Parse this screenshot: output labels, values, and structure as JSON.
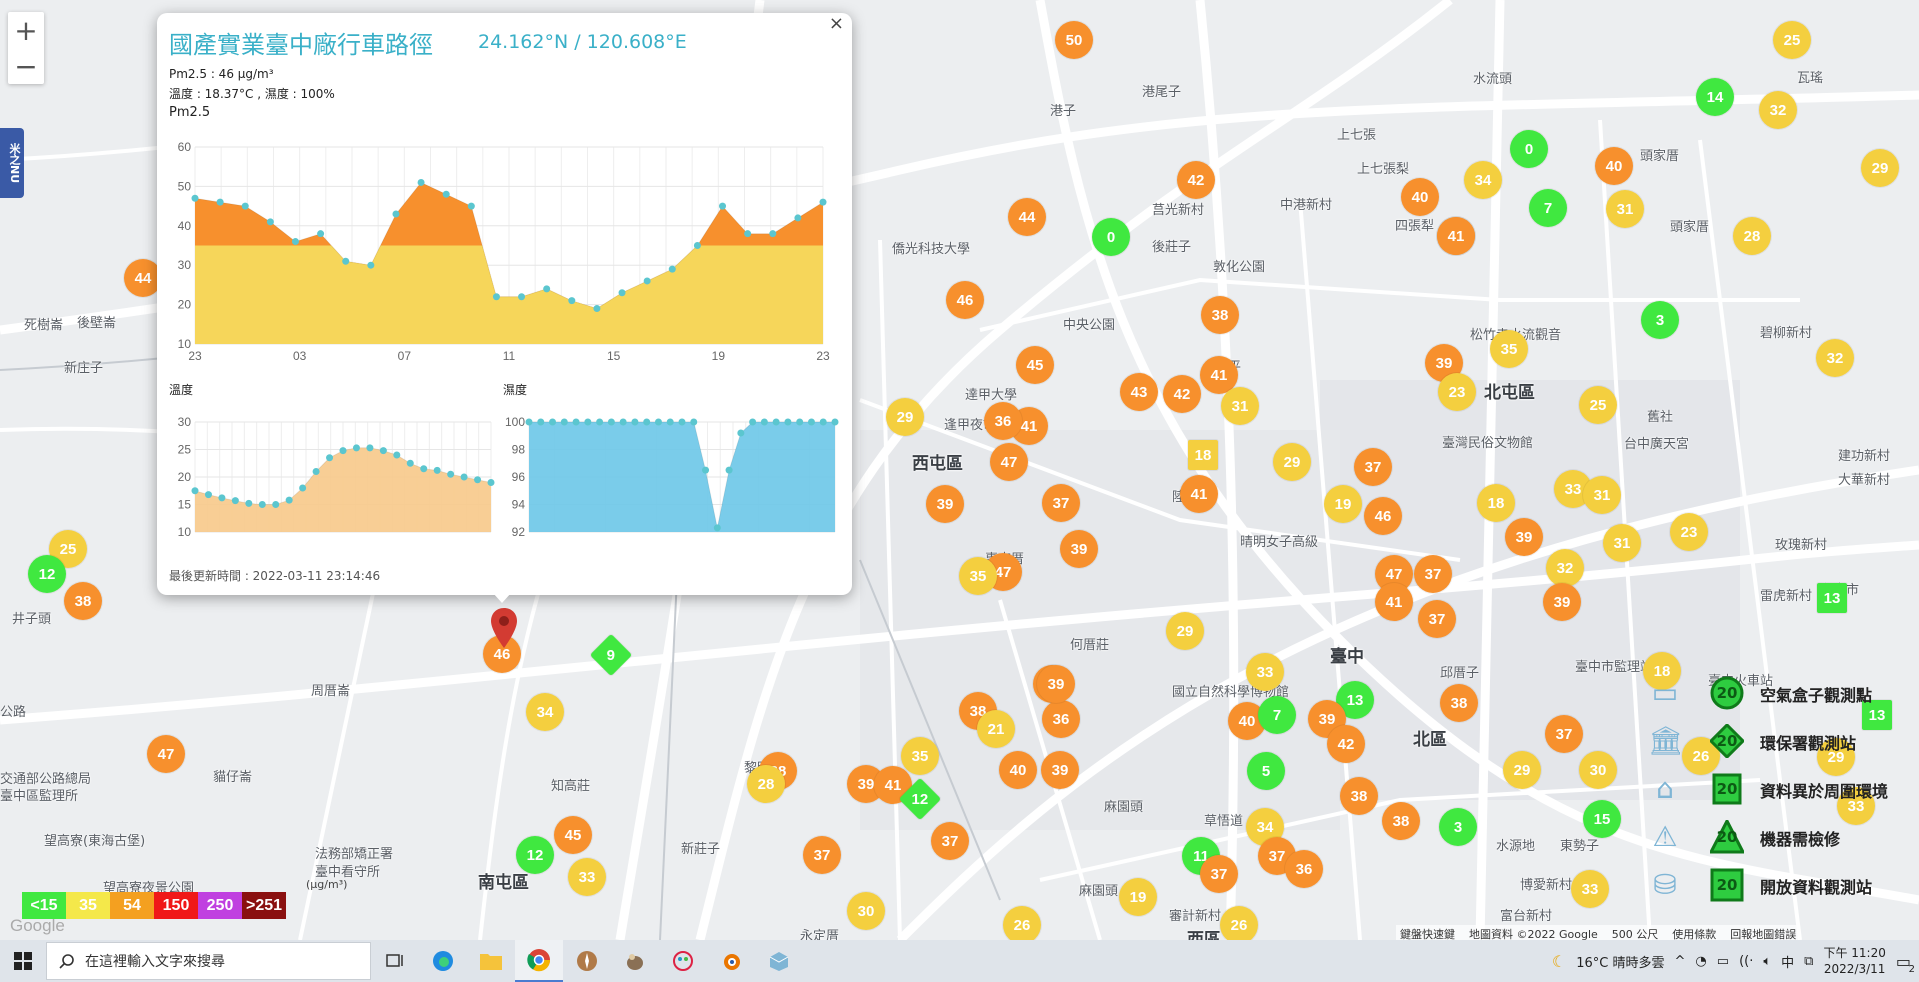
{
  "map": {
    "zoom_in": "+",
    "zoom_out": "−",
    "side_tab_label": "米之NU",
    "google_logo": "Google",
    "places": [
      {
        "t": "港尾子",
        "x": 1142,
        "y": 81
      },
      {
        "t": "港子",
        "x": 1050,
        "y": 100
      },
      {
        "t": "上七張",
        "x": 1337,
        "y": 124
      },
      {
        "t": "上七張梨",
        "x": 1357,
        "y": 158
      },
      {
        "t": "中港新村",
        "x": 1280,
        "y": 194
      },
      {
        "t": "後莊子",
        "x": 1152,
        "y": 236
      },
      {
        "t": "莒光新村",
        "x": 1152,
        "y": 199
      },
      {
        "t": "敦化公園",
        "x": 1213,
        "y": 256
      },
      {
        "t": "中央公園",
        "x": 1063,
        "y": 314
      },
      {
        "t": "四張犁",
        "x": 1395,
        "y": 215
      },
      {
        "t": "頭家厝",
        "x": 1640,
        "y": 145
      },
      {
        "t": "頭家厝",
        "x": 1670,
        "y": 216
      },
      {
        "t": "瓦瑤",
        "x": 1797,
        "y": 67
      },
      {
        "t": "水流頭",
        "x": 1473,
        "y": 68
      },
      {
        "t": "北屯區",
        "x": 1484,
        "y": 378
      },
      {
        "t": "碧柳新村",
        "x": 1760,
        "y": 322
      },
      {
        "t": "松竹寺水流觀音",
        "x": 1470,
        "y": 324
      },
      {
        "t": "臺灣民俗文物館",
        "x": 1442,
        "y": 432
      },
      {
        "t": "舊社",
        "x": 1647,
        "y": 406
      },
      {
        "t": "建功新村",
        "x": 1838,
        "y": 445
      },
      {
        "t": "大華新村",
        "x": 1838,
        "y": 469
      },
      {
        "t": "玫瑰新村",
        "x": 1775,
        "y": 534
      },
      {
        "t": "雷虎新村",
        "x": 1760,
        "y": 585
      },
      {
        "t": "西屯區",
        "x": 912,
        "y": 449
      },
      {
        "t": "陳平",
        "x": 1215,
        "y": 356
      },
      {
        "t": "陸光七",
        "x": 1172,
        "y": 486
      },
      {
        "t": "惠來厝",
        "x": 985,
        "y": 548
      },
      {
        "t": "何厝莊",
        "x": 1070,
        "y": 634
      },
      {
        "t": "臺中",
        "x": 1330,
        "y": 642
      },
      {
        "t": "北區",
        "x": 1413,
        "y": 725
      },
      {
        "t": "邱厝子",
        "x": 1440,
        "y": 662
      },
      {
        "t": "東勢子",
        "x": 1560,
        "y": 835
      },
      {
        "t": "水源地",
        "x": 1496,
        "y": 835
      },
      {
        "t": "博愛新村",
        "x": 1520,
        "y": 874
      },
      {
        "t": "富台新村",
        "x": 1500,
        "y": 905
      },
      {
        "t": "草悟道",
        "x": 1204,
        "y": 810
      },
      {
        "t": "審計新村",
        "x": 1169,
        "y": 905
      },
      {
        "t": "西區",
        "x": 1187,
        "y": 925
      },
      {
        "t": "麻園頭",
        "x": 1104,
        "y": 796
      },
      {
        "t": "麻園頭",
        "x": 1079,
        "y": 880
      },
      {
        "t": "黎明新村",
        "x": 744,
        "y": 757
      },
      {
        "t": "知高莊",
        "x": 551,
        "y": 775
      },
      {
        "t": "新莊子",
        "x": 681,
        "y": 838
      },
      {
        "t": "永定厝",
        "x": 800,
        "y": 925
      },
      {
        "t": "南屯區",
        "x": 478,
        "y": 868
      },
      {
        "t": "周厝崙",
        "x": 311,
        "y": 680
      },
      {
        "t": "貓仔崙",
        "x": 213,
        "y": 766
      },
      {
        "t": "井子頭",
        "x": 12,
        "y": 608
      },
      {
        "t": "新庄子",
        "x": 64,
        "y": 357
      },
      {
        "t": "後壁崙",
        "x": 77,
        "y": 312
      },
      {
        "t": "死樹崙",
        "x": 24,
        "y": 314
      },
      {
        "t": "望高寮夜景公園",
        "x": 103,
        "y": 877
      },
      {
        "t": "望高寮(東海古堡)",
        "x": 44,
        "y": 830
      },
      {
        "t": "法務部矯正署",
        "x": 315,
        "y": 843
      },
      {
        "t": "臺中看守所",
        "x": 315,
        "y": 861
      },
      {
        "t": "交通部公路總局",
        "x": 0,
        "y": 768
      },
      {
        "t": "臺中區監理所",
        "x": 0,
        "y": 785
      },
      {
        "t": "公路",
        "x": 0,
        "y": 701
      },
      {
        "t": "達甲大學",
        "x": 965,
        "y": 384
      },
      {
        "t": "逢甲夜市",
        "x": 944,
        "y": 414
      },
      {
        "t": "僑光科技大學",
        "x": 892,
        "y": 238
      },
      {
        "t": "臺中市監理站",
        "x": 1575,
        "y": 656
      },
      {
        "t": "臺中火車站",
        "x": 1708,
        "y": 670
      },
      {
        "t": "晴明女子高級",
        "x": 1240,
        "y": 531
      },
      {
        "t": "國立自然科學博物館",
        "x": 1172,
        "y": 681
      },
      {
        "t": "台中廣天宮",
        "x": 1624,
        "y": 433
      },
      {
        "t": "台中市",
        "x": 1820,
        "y": 579
      }
    ],
    "markers": [
      {
        "v": "50",
        "x": 1074,
        "y": 40,
        "c": "#f7902d"
      },
      {
        "v": "14",
        "x": 1715,
        "y": 97,
        "c": "#40e840"
      },
      {
        "v": "25",
        "x": 1792,
        "y": 40,
        "c": "#f4cf3f"
      },
      {
        "v": "32",
        "x": 1778,
        "y": 110,
        "c": "#f4cf3f"
      },
      {
        "v": "0",
        "x": 1529,
        "y": 149,
        "c": "#40e840"
      },
      {
        "v": "40",
        "x": 1614,
        "y": 166,
        "c": "#f7902d"
      },
      {
        "v": "29",
        "x": 1880,
        "y": 168,
        "c": "#f4cf3f"
      },
      {
        "v": "42",
        "x": 1196,
        "y": 180,
        "c": "#f7902d"
      },
      {
        "v": "40",
        "x": 1420,
        "y": 197,
        "c": "#f7902d"
      },
      {
        "v": "34",
        "x": 1483,
        "y": 180,
        "c": "#f4cf3f"
      },
      {
        "v": "7",
        "x": 1548,
        "y": 208,
        "c": "#40e840"
      },
      {
        "v": "31",
        "x": 1625,
        "y": 209,
        "c": "#f4cf3f"
      },
      {
        "v": "44",
        "x": 1027,
        "y": 217,
        "c": "#f7902d"
      },
      {
        "v": "0",
        "x": 1111,
        "y": 237,
        "c": "#40e840"
      },
      {
        "v": "41",
        "x": 1456,
        "y": 236,
        "c": "#f7902d"
      },
      {
        "v": "28",
        "x": 1752,
        "y": 236,
        "c": "#f4cf3f"
      },
      {
        "v": "44",
        "x": 143,
        "y": 278,
        "c": "#f7902d"
      },
      {
        "v": "46",
        "x": 965,
        "y": 300,
        "c": "#f7902d"
      },
      {
        "v": "38",
        "x": 1220,
        "y": 315,
        "c": "#f7902d"
      },
      {
        "v": "3",
        "x": 1660,
        "y": 320,
        "c": "#40e840"
      },
      {
        "v": "35",
        "x": 1509,
        "y": 349,
        "c": "#f4cf3f"
      },
      {
        "v": "32",
        "x": 1835,
        "y": 358,
        "c": "#f4cf3f"
      },
      {
        "v": "45",
        "x": 1035,
        "y": 365,
        "c": "#f7902d"
      },
      {
        "v": "39",
        "x": 1444,
        "y": 363,
        "c": "#f7902d"
      },
      {
        "v": "41",
        "x": 1219,
        "y": 375,
        "c": "#f7902d"
      },
      {
        "v": "43",
        "x": 1139,
        "y": 392,
        "c": "#f7902d"
      },
      {
        "v": "42",
        "x": 1182,
        "y": 394,
        "c": "#f7902d"
      },
      {
        "v": "23",
        "x": 1457,
        "y": 392,
        "c": "#f4cf3f"
      },
      {
        "v": "25",
        "x": 1598,
        "y": 405,
        "c": "#f4cf3f"
      },
      {
        "v": "31",
        "x": 1240,
        "y": 406,
        "c": "#f4cf3f"
      },
      {
        "v": "29",
        "x": 905,
        "y": 417,
        "c": "#f4cf3f"
      },
      {
        "v": "41",
        "x": 1029,
        "y": 426,
        "c": "#f7902d"
      },
      {
        "v": "36",
        "x": 1003,
        "y": 421,
        "c": "#f7902d"
      },
      {
        "v": "47",
        "x": 1009,
        "y": 462,
        "c": "#f7902d"
      },
      {
        "v": "29",
        "x": 1292,
        "y": 462,
        "c": "#f4cf3f"
      },
      {
        "v": "37",
        "x": 1373,
        "y": 467,
        "c": "#f7902d"
      },
      {
        "v": "41",
        "x": 1199,
        "y": 494,
        "c": "#f7902d"
      },
      {
        "v": "33",
        "x": 1573,
        "y": 489,
        "c": "#f4cf3f"
      },
      {
        "v": "31",
        "x": 1602,
        "y": 495,
        "c": "#f4cf3f"
      },
      {
        "v": "39",
        "x": 945,
        "y": 504,
        "c": "#f7902d"
      },
      {
        "v": "37",
        "x": 1061,
        "y": 503,
        "c": "#f7902d"
      },
      {
        "v": "19",
        "x": 1343,
        "y": 504,
        "c": "#f4cf3f"
      },
      {
        "v": "18",
        "x": 1496,
        "y": 503,
        "c": "#f4cf3f"
      },
      {
        "v": "46",
        "x": 1383,
        "y": 516,
        "c": "#f7902d"
      },
      {
        "v": "39",
        "x": 1524,
        "y": 537,
        "c": "#f7902d"
      },
      {
        "v": "23",
        "x": 1689,
        "y": 532,
        "c": "#f4cf3f"
      },
      {
        "v": "31",
        "x": 1622,
        "y": 543,
        "c": "#f4cf3f"
      },
      {
        "v": "25",
        "x": 68,
        "y": 549,
        "c": "#f4cf3f"
      },
      {
        "v": "12",
        "x": 47,
        "y": 574,
        "c": "#40e840"
      },
      {
        "v": "39",
        "x": 1079,
        "y": 549,
        "c": "#f7902d"
      },
      {
        "v": "47",
        "x": 1003,
        "y": 572,
        "c": "#f7902d"
      },
      {
        "v": "35",
        "x": 978,
        "y": 576,
        "c": "#f4cf3f"
      },
      {
        "v": "47",
        "x": 1394,
        "y": 574,
        "c": "#f7902d"
      },
      {
        "v": "37",
        "x": 1433,
        "y": 574,
        "c": "#f7902d"
      },
      {
        "v": "32",
        "x": 1565,
        "y": 568,
        "c": "#f4cf3f"
      },
      {
        "v": "41",
        "x": 1394,
        "y": 602,
        "c": "#f7902d"
      },
      {
        "v": "37",
        "x": 1437,
        "y": 619,
        "c": "#f7902d"
      },
      {
        "v": "39",
        "x": 1562,
        "y": 602,
        "c": "#f7902d"
      },
      {
        "v": "38",
        "x": 83,
        "y": 601,
        "c": "#f7902d"
      },
      {
        "v": "29",
        "x": 1185,
        "y": 631,
        "c": "#f4cf3f"
      },
      {
        "v": "33",
        "x": 1265,
        "y": 672,
        "c": "#f4cf3f"
      },
      {
        "v": "39",
        "x": 1052,
        "y": 684,
        "c": "#f7902d"
      },
      {
        "v": "36",
        "x": 1061,
        "y": 719,
        "c": "#f7902d"
      },
      {
        "v": "13",
        "x": 1355,
        "y": 700,
        "c": "#40e840"
      },
      {
        "v": "38",
        "x": 1459,
        "y": 703,
        "c": "#f7902d"
      },
      {
        "v": "18",
        "x": 1662,
        "y": 671,
        "c": "#f4cf3f"
      },
      {
        "v": "38",
        "x": 978,
        "y": 711,
        "c": "#f7902d"
      },
      {
        "v": "21",
        "x": 996,
        "y": 729,
        "c": "#f4cf3f"
      },
      {
        "v": "40",
        "x": 1247,
        "y": 721,
        "c": "#f7902d"
      },
      {
        "v": "7",
        "x": 1277,
        "y": 715,
        "c": "#40e840"
      },
      {
        "v": "39",
        "x": 1327,
        "y": 719,
        "c": "#f7902d"
      },
      {
        "v": "42",
        "x": 1346,
        "y": 744,
        "c": "#f7902d"
      },
      {
        "v": "37",
        "x": 1564,
        "y": 734,
        "c": "#f7902d"
      },
      {
        "v": "34",
        "x": 545,
        "y": 712,
        "c": "#f4cf3f"
      },
      {
        "v": "47",
        "x": 166,
        "y": 754,
        "c": "#f7902d"
      },
      {
        "v": "35",
        "x": 920,
        "y": 756,
        "c": "#f4cf3f"
      },
      {
        "v": "38",
        "x": 778,
        "y": 771,
        "c": "#f7902d"
      },
      {
        "v": "28",
        "x": 766,
        "y": 784,
        "c": "#f4cf3f"
      },
      {
        "v": "40",
        "x": 1018,
        "y": 770,
        "c": "#f7902d"
      },
      {
        "v": "39",
        "x": 1060,
        "y": 770,
        "c": "#f7902d"
      },
      {
        "v": "5",
        "x": 1266,
        "y": 771,
        "c": "#40e840"
      },
      {
        "v": "29",
        "x": 1522,
        "y": 770,
        "c": "#f4cf3f"
      },
      {
        "v": "30",
        "x": 1598,
        "y": 770,
        "c": "#f4cf3f"
      },
      {
        "v": "26",
        "x": 1701,
        "y": 756,
        "c": "#f4cf3f"
      },
      {
        "v": "29",
        "x": 1836,
        "y": 757,
        "c": "#f4cf3f"
      },
      {
        "v": "39",
        "x": 866,
        "y": 784,
        "c": "#f7902d"
      },
      {
        "v": "41",
        "x": 893,
        "y": 785,
        "c": "#f7902d"
      },
      {
        "v": "38",
        "x": 1359,
        "y": 796,
        "c": "#f7902d"
      },
      {
        "v": "15",
        "x": 1602,
        "y": 819,
        "c": "#40e840"
      },
      {
        "v": "33",
        "x": 1856,
        "y": 806,
        "c": "#f4cf3f"
      },
      {
        "v": "34",
        "x": 1265,
        "y": 827,
        "c": "#f4cf3f"
      },
      {
        "v": "38",
        "x": 1401,
        "y": 821,
        "c": "#f7902d"
      },
      {
        "v": "3",
        "x": 1458,
        "y": 827,
        "c": "#40e840"
      },
      {
        "v": "45",
        "x": 573,
        "y": 835,
        "c": "#f7902d"
      },
      {
        "v": "37",
        "x": 950,
        "y": 841,
        "c": "#f7902d"
      },
      {
        "v": "12",
        "x": 535,
        "y": 855,
        "c": "#40e840"
      },
      {
        "v": "37",
        "x": 822,
        "y": 855,
        "c": "#f7902d"
      },
      {
        "v": "11",
        "x": 1201,
        "y": 856,
        "c": "#40e840"
      },
      {
        "v": "37",
        "x": 1277,
        "y": 856,
        "c": "#f7902d"
      },
      {
        "v": "36",
        "x": 1304,
        "y": 869,
        "c": "#f7902d"
      },
      {
        "v": "37",
        "x": 1219,
        "y": 874,
        "c": "#f7902d"
      },
      {
        "v": "33",
        "x": 587,
        "y": 877,
        "c": "#f4cf3f"
      },
      {
        "v": "19",
        "x": 1138,
        "y": 897,
        "c": "#f4cf3f"
      },
      {
        "v": "33",
        "x": 1590,
        "y": 889,
        "c": "#f4cf3f"
      },
      {
        "v": "30",
        "x": 866,
        "y": 911,
        "c": "#f4cf3f"
      },
      {
        "v": "26",
        "x": 1022,
        "y": 925,
        "c": "#f4cf3f"
      },
      {
        "v": "26",
        "x": 1239,
        "y": 925,
        "c": "#f4cf3f"
      },
      {
        "v": "46",
        "x": 502,
        "y": 654,
        "c": "#f7902d"
      },
      {
        "v": "39",
        "x": 1056,
        "y": 684,
        "c": "#f7902d"
      },
      {
        "v": "41",
        "x": 1456,
        "y": 236,
        "c": "#f7902d"
      }
    ],
    "square_markers": [
      {
        "v": "18",
        "x": 1203,
        "y": 455,
        "c": "#f4cf3f"
      },
      {
        "v": "13",
        "x": 1832,
        "y": 598,
        "c": "#40e840"
      },
      {
        "v": "13",
        "x": 1877,
        "y": 715,
        "c": "#40e840"
      }
    ],
    "diamond_markers": [
      {
        "v": "9",
        "x": 611,
        "y": 655,
        "c": "#40e840"
      },
      {
        "v": "12",
        "x": 920,
        "y": 799,
        "c": "#40e840"
      }
    ]
  },
  "popup": {
    "title": "國產實業臺中廠行車路徑",
    "coords": "24.162°N / 120.608°E",
    "pm25_line": "Pm2.5 : 46 μg/m³",
    "weather_line": "溫度 : 18.37°C , 濕度 : 100%",
    "pm_chart_label": "Pm2.5",
    "temp_chart_label": "溫度",
    "hum_chart_label": "濕度",
    "updated": "最後更新時間 : 2022-03-11 23:14:46",
    "close": "×"
  },
  "chart_data": [
    {
      "type": "area",
      "title": "Pm2.5",
      "x_ticks": [
        "23",
        "03",
        "07",
        "11",
        "15",
        "19",
        "23"
      ],
      "ylim": [
        10,
        60
      ],
      "y_ticks": [
        10,
        20,
        30,
        40,
        50,
        60
      ],
      "values": [
        47,
        46,
        45,
        41,
        36,
        38,
        31,
        30,
        43,
        51,
        48,
        45,
        22,
        22,
        24,
        21,
        19,
        23,
        26,
        29,
        35,
        45,
        38,
        38,
        42,
        46
      ],
      "threshold": 35,
      "colors": {
        "above": "#f7902d",
        "below": "#f6d65a",
        "point": "#5bc6cf"
      }
    },
    {
      "type": "area",
      "title": "溫度",
      "ylim": [
        10,
        30
      ],
      "y_ticks": [
        10,
        15,
        20,
        25,
        30
      ],
      "values": [
        17.5,
        16.8,
        16.2,
        15.7,
        15.2,
        15,
        15,
        15.8,
        18,
        21,
        23.5,
        24.8,
        25.3,
        25.3,
        24.8,
        24,
        22.5,
        21.5,
        21.2,
        20.5,
        20,
        19.5,
        19
      ],
      "colors": {
        "fill": "#f7c98a",
        "point": "#5bc6cf"
      }
    },
    {
      "type": "area",
      "title": "濕度",
      "ylim": [
        92,
        100
      ],
      "y_ticks": [
        92,
        94,
        96,
        98,
        100
      ],
      "values": [
        100,
        100,
        100,
        100,
        100,
        100,
        100,
        100,
        100,
        100,
        100,
        100,
        100,
        100,
        100,
        96.5,
        92.3,
        96.5,
        99.2,
        100,
        100,
        100,
        100,
        100,
        100,
        100,
        100
      ],
      "colors": {
        "fill": "#6cc6e8",
        "point": "#5bc6cf"
      }
    }
  ],
  "legend": {
    "scale": [
      {
        "label": "<15",
        "color": "#40e840"
      },
      {
        "label": "35",
        "color": "#f4e84a"
      },
      {
        "label": "54",
        "color": "#f4a020"
      },
      {
        "label": "150",
        "color": "#f01818"
      },
      {
        "label": "250",
        "color": "#c040e0"
      },
      {
        "label": ">251",
        "color": "#8a1010"
      }
    ],
    "unit": "(μg/m³)",
    "types": [
      {
        "label": "空氣盒子觀測點",
        "shape": "circle",
        "value": "20"
      },
      {
        "label": "環保署觀測站",
        "shape": "diamond",
        "value": "20"
      },
      {
        "label": "資料異於周圍環境",
        "shape": "hexagon",
        "value": "20"
      },
      {
        "label": "機器需檢修",
        "shape": "triangle",
        "value": "20"
      },
      {
        "label": "開放資料觀測站",
        "shape": "square",
        "value": "20"
      }
    ]
  },
  "attribution": {
    "shortcuts": "鍵盤快速鍵",
    "data": "地圖資料 ©2022 Google",
    "scale": "500 公尺",
    "terms": "使用條款",
    "report": "回報地圖錯誤"
  },
  "taskbar": {
    "search_placeholder": "在這裡輸入文字來搜尋",
    "weather": "16°C 晴時多雲",
    "ime": "中",
    "time": "下午 11:20",
    "date": "2022/3/11",
    "notifications": "2"
  }
}
